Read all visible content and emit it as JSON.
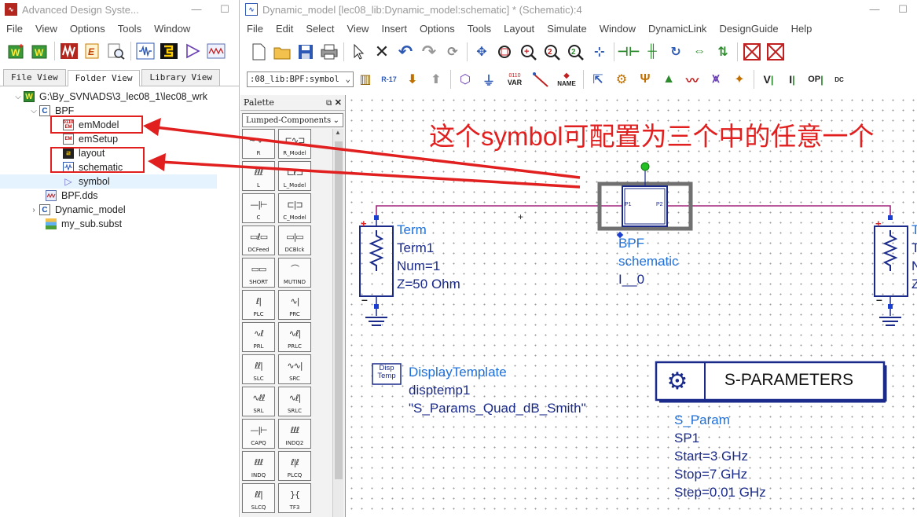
{
  "left_window": {
    "title": "Advanced Design Syste...",
    "menus": [
      "File",
      "View",
      "Options",
      "Tools",
      "Window"
    ],
    "toolbar_icons": [
      "new-workspace-icon",
      "open-workspace-icon",
      "waveform-icon",
      "edit-icon",
      "search-icon",
      "schematic-icon",
      "layout-icon",
      "symbol-icon",
      "dds-icon"
    ],
    "tabs": [
      "File View",
      "Folder View",
      "Library View"
    ],
    "active_tab": "Folder View",
    "tree": {
      "root": "G:\\By_SVN\\ADS\\3_lec08_1\\lec08_wrk",
      "bpf": "BPF",
      "emModel": "emModel",
      "emSetup": "emSetup",
      "layout": "layout",
      "schematic": "schematic",
      "symbol": "symbol",
      "bpf_dds": "BPF.dds",
      "dynamic_model": "Dynamic_model",
      "my_sub": "my_sub.subst"
    }
  },
  "right_window": {
    "title": "Dynamic_model [lec08_lib:Dynamic_model:schematic] * (Schematic):4",
    "menus": [
      "File",
      "Edit",
      "Select",
      "View",
      "Insert",
      "Options",
      "Tools",
      "Layout",
      "Simulate",
      "Window",
      "DynamicLink",
      "DesignGuide",
      "Help"
    ],
    "component_select": ":08_lib:BPF:symbol",
    "var_label": "VAR",
    "name_label": "NAME",
    "toolbar2_labels": [
      "V",
      "I",
      "OP",
      "DC"
    ]
  },
  "palette": {
    "title": "Palette",
    "category": "Lumped-Components",
    "items": [
      "R",
      "R_Model",
      "L",
      "L_Model",
      "C",
      "C_Model",
      "DCFeed",
      "DCBlck",
      "SHORT",
      "MUTIND",
      "PLC",
      "PRC",
      "PRL",
      "PRLC",
      "SLC",
      "SRC",
      "SRL",
      "SRLC",
      "CAPQ",
      "INDQ2",
      "INDQ",
      "PLCQ",
      "SLCQ",
      "TF3"
    ]
  },
  "schematic": {
    "annotation": "这个symbol可配置为三个中的任意一个",
    "bpf": {
      "ref": "BPF",
      "view": "schematic",
      "inst": "I__0",
      "p1": "P1",
      "p2": "P2"
    },
    "term1": {
      "type": "Term",
      "name": "Term1",
      "num": "Num=1",
      "z": "Z=50 Ohm"
    },
    "term2_partial": {
      "type": "T",
      "name": "T",
      "num": "N",
      "z": "Z"
    },
    "display_template": {
      "icon_top": "Disp",
      "icon_bottom": "Temp",
      "type": "DisplayTemplate",
      "name": "disptemp1",
      "value": "\"S_Params_Quad_dB_Smith\""
    },
    "sparam": {
      "header": "S-PARAMETERS",
      "type": "S_Param",
      "name": "SP1",
      "start": "Start=3 GHz",
      "stop": "Stop=7 GHz",
      "step": "Step=0.01 GHz"
    }
  },
  "colors": {
    "annotation_red": "#e11f1f",
    "wire": "#a0237a",
    "component_blue": "#1a2a8a",
    "label_blue": "#1e6fd9"
  }
}
